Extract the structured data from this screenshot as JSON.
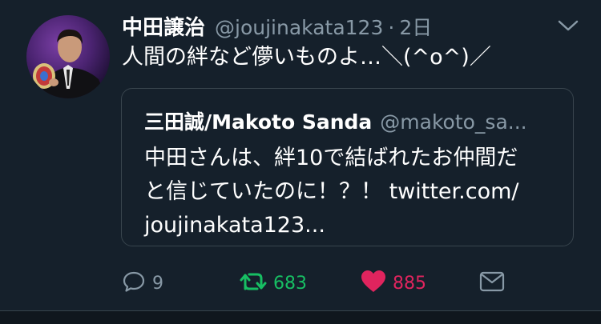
{
  "tweet": {
    "author": {
      "display_name": "中田譲治",
      "handle": "@joujinakata123",
      "avatar_icon": "profile-photo"
    },
    "separator": "·",
    "time": "2日",
    "text": "人間の絆など儚いものよ…＼(^o^)／",
    "menu_icon": "chevron-down-icon",
    "quote": {
      "display_name": "三田誠/Makoto Sanda",
      "handle": "@makoto_sa...",
      "text_lines": [
        "中田さんは、絆10で結ばれたお仲間だ",
        "と信じていたのに！？！ twitter.com/",
        "joujinakata123..."
      ]
    },
    "actions": {
      "reply": {
        "icon": "reply-icon",
        "count": "9"
      },
      "retweet": {
        "icon": "retweet-icon",
        "count": "683"
      },
      "like": {
        "icon": "heart-icon",
        "count": "885"
      },
      "dm": {
        "icon": "mail-icon"
      }
    }
  },
  "colors": {
    "background": "#15202b",
    "secondary_text": "#8899a6",
    "retweet": "#17bf63",
    "like": "#e0245e",
    "border": "#38444d"
  }
}
